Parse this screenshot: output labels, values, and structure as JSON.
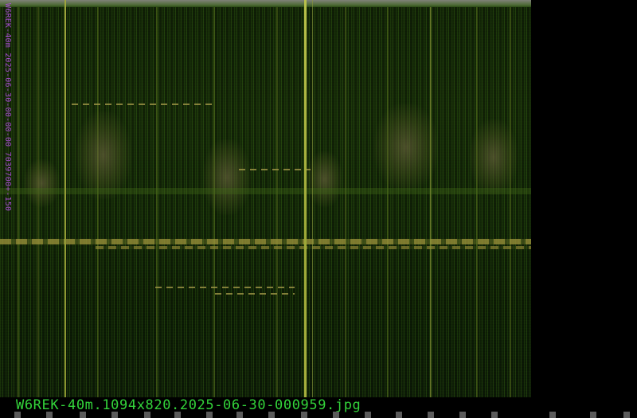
{
  "image": {
    "vertical_label": "W6REK-40m 2025-06-30-00-00-00 7039700+-150",
    "filename": "W6REK-40m.1094x820.2025-06-30-000959.jpg"
  },
  "colors": {
    "background": "#000000",
    "label_magenta": "#a54bcf",
    "filename_green": "#33d43a",
    "carrier_yellow": "#b9c04a",
    "waterfall_green": "#223f0d"
  }
}
